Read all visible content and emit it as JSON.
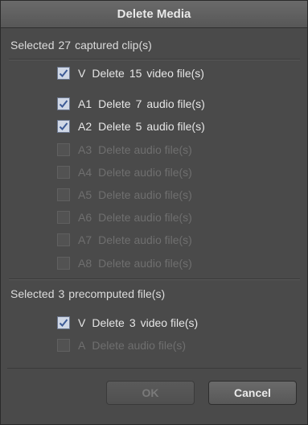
{
  "dialog": {
    "title": "Delete Media"
  },
  "captured": {
    "label_pre": "Selected",
    "count": "27",
    "label_post": "captured clip(s)",
    "tracks": [
      {
        "track": "V",
        "pre": "Delete",
        "count": "15",
        "post": "video file(s)",
        "checked": true,
        "enabled": true
      },
      {
        "track": "A1",
        "pre": "Delete",
        "count": "7",
        "post": "audio file(s)",
        "checked": true,
        "enabled": true
      },
      {
        "track": "A2",
        "pre": "Delete",
        "count": "5",
        "post": "audio file(s)",
        "checked": true,
        "enabled": true
      },
      {
        "track": "A3",
        "text": "Delete audio file(s)",
        "checked": false,
        "enabled": false
      },
      {
        "track": "A4",
        "text": "Delete audio file(s)",
        "checked": false,
        "enabled": false
      },
      {
        "track": "A5",
        "text": "Delete audio file(s)",
        "checked": false,
        "enabled": false
      },
      {
        "track": "A6",
        "text": "Delete audio file(s)",
        "checked": false,
        "enabled": false
      },
      {
        "track": "A7",
        "text": "Delete audio file(s)",
        "checked": false,
        "enabled": false
      },
      {
        "track": "A8",
        "text": "Delete audio file(s)",
        "checked": false,
        "enabled": false
      }
    ]
  },
  "precomputed": {
    "label_pre": "Selected",
    "count": "3",
    "label_post": "precomputed file(s)",
    "tracks": [
      {
        "track": "V",
        "pre": "Delete",
        "count": "3",
        "post": "video file(s)",
        "checked": true,
        "enabled": true
      },
      {
        "track": "A",
        "text": "Delete audio file(s)",
        "checked": false,
        "enabled": false
      }
    ]
  },
  "buttons": {
    "ok": "OK",
    "cancel": "Cancel",
    "ok_enabled": false
  }
}
